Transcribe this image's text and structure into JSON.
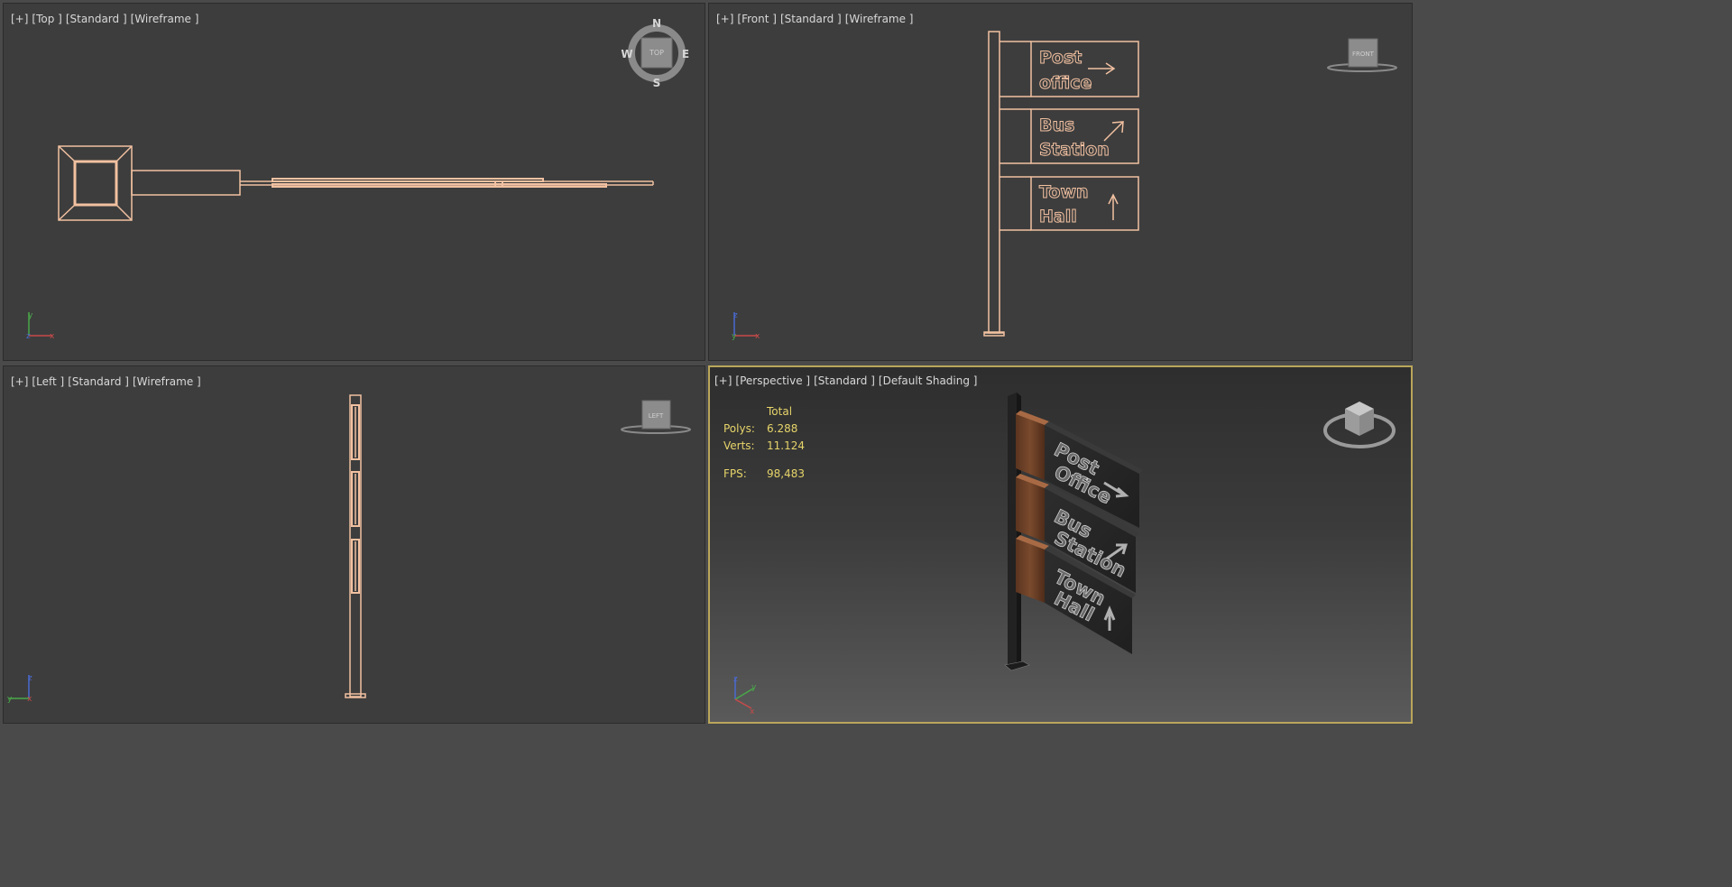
{
  "viewports": {
    "top": {
      "plus": "[+]",
      "view": "[Top ]",
      "preset": "[Standard ]",
      "mode": "[Wireframe ]",
      "compass": {
        "n": "N",
        "s": "S",
        "e": "E",
        "w": "W",
        "cube": "TOP"
      }
    },
    "front": {
      "plus": "[+]",
      "view": "[Front ]",
      "preset": "[Standard ]",
      "mode": "[Wireframe ]",
      "cube": "FRONT",
      "signs": [
        "Post",
        "office",
        "Bus",
        "Station",
        "Town",
        "Hall"
      ]
    },
    "left": {
      "plus": "[+]",
      "view": "[Left ]",
      "preset": "[Standard ]",
      "mode": "[Wireframe ]",
      "cube": "LEFT"
    },
    "perspective": {
      "plus": "[+]",
      "view": "[Perspective ]",
      "preset": "[Standard ]",
      "mode": "[Default Shading ]",
      "signs": [
        "Post",
        "Office",
        "Bus",
        "Station",
        "Town",
        "Hall"
      ],
      "stats": {
        "total_label": "Total",
        "polys_label": "Polys:",
        "polys": "6.288",
        "verts_label": "Verts:",
        "verts": "11.124",
        "fps_label": "FPS:",
        "fps": "98,483"
      }
    }
  },
  "colors": {
    "wire": "#f2c1a1",
    "viewport_bg": "#3d3d3d",
    "active_border": "#b9a65a",
    "stats": "#e6d46a"
  },
  "axis_labels": {
    "x": "x",
    "y": "y",
    "z": "z"
  }
}
